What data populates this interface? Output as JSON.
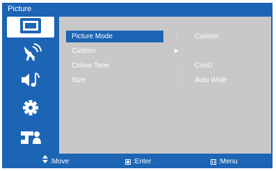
{
  "window": {
    "title": "Picture"
  },
  "sidebar": {
    "items": [
      {
        "icon": "picture-icon",
        "active": true
      },
      {
        "icon": "antenna-icon",
        "active": false
      },
      {
        "icon": "sound-icon",
        "active": false
      },
      {
        "icon": "settings-icon",
        "active": false
      },
      {
        "icon": "input-icon",
        "active": false
      }
    ]
  },
  "menu": {
    "rows": [
      {
        "label": "Picture Mode",
        "separator": ":",
        "value": "Custom"
      },
      {
        "label": "Custom",
        "separator": "►",
        "value": ""
      },
      {
        "label": "Colour Tone",
        "separator": ":",
        "value": "Cool2"
      },
      {
        "label": "Size",
        "separator": ":",
        "value": "Auto Wide"
      }
    ]
  },
  "footer": {
    "move": {
      "icon": "updown-arrow-icon",
      "label": ":Move"
    },
    "enter": {
      "icon": "enter-key-icon",
      "label": ":Enter"
    },
    "menu": {
      "icon": "menu-key-icon",
      "label": ":Menu"
    }
  },
  "colors": {
    "accent": "#1c64b4",
    "panel": "#c8c8c8",
    "text": "#ffffff"
  }
}
